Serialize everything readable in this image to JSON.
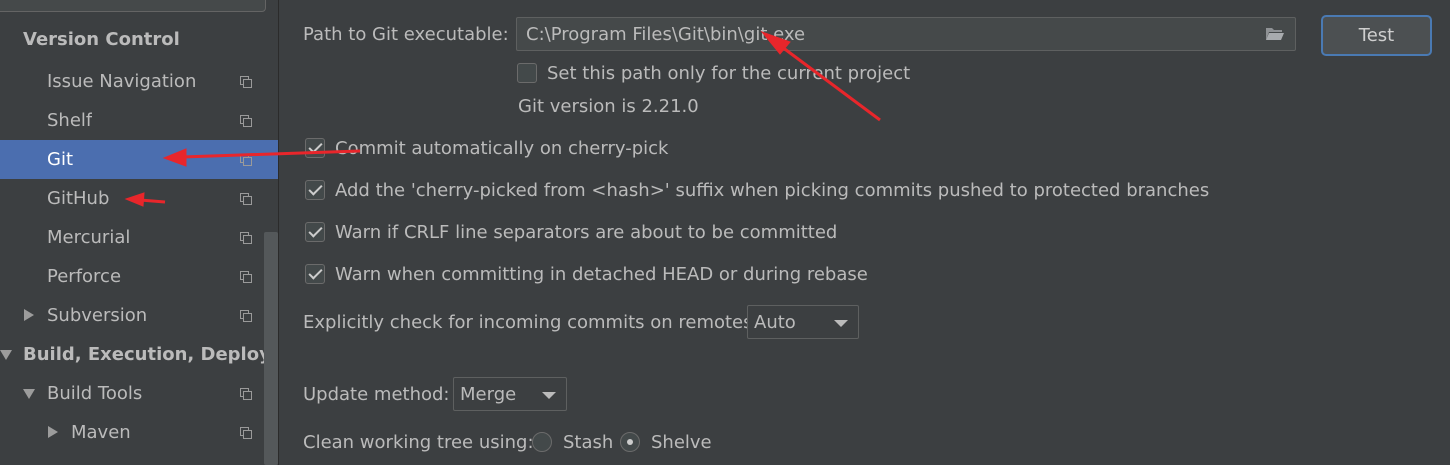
{
  "sidebar": {
    "section_title": "Version Control",
    "items": [
      {
        "label": "Issue Navigation"
      },
      {
        "label": "Shelf"
      },
      {
        "label": "Git"
      },
      {
        "label": "GitHub"
      },
      {
        "label": "Mercurial"
      },
      {
        "label": "Perforce"
      },
      {
        "label": "Subversion"
      },
      {
        "label": "Build, Execution, Deploym"
      },
      {
        "label": "Build Tools"
      },
      {
        "label": "Maven"
      }
    ],
    "selected": "Git"
  },
  "git": {
    "path_label": "Path to Git executable:",
    "path_value": "C:\\Program Files\\Git\\bin\\git.exe",
    "test_button": "Test",
    "current_project_only": {
      "label": "Set this path only for the current project",
      "checked": false
    },
    "version_text": "Git version is 2.21.0",
    "options": [
      {
        "label": "Commit automatically on cherry-pick",
        "checked": true
      },
      {
        "label": "Add the 'cherry-picked from <hash>' suffix when picking commits pushed to protected branches",
        "checked": true
      },
      {
        "label": "Warn if CRLF line separators are about to be committed",
        "checked": true
      },
      {
        "label": "Warn when committing in detached HEAD or during rebase",
        "checked": true
      }
    ],
    "incoming_label": "Explicitly check for incoming commits on remotes:",
    "incoming_value": "Auto",
    "update_label": "Update method:",
    "update_value": "Merge",
    "clean_label": "Clean working tree using:",
    "clean_options": [
      {
        "label": "Stash",
        "checked": false
      },
      {
        "label": "Shelve",
        "checked": true
      }
    ]
  },
  "icons": {
    "folder": "folder-open-icon",
    "page": "copy-settings-icon"
  },
  "colors": {
    "background": "#3c3f41",
    "selection": "#4b6eaf",
    "annotation_arrow": "#e8262b",
    "button_focus": "#4a7ab3"
  }
}
